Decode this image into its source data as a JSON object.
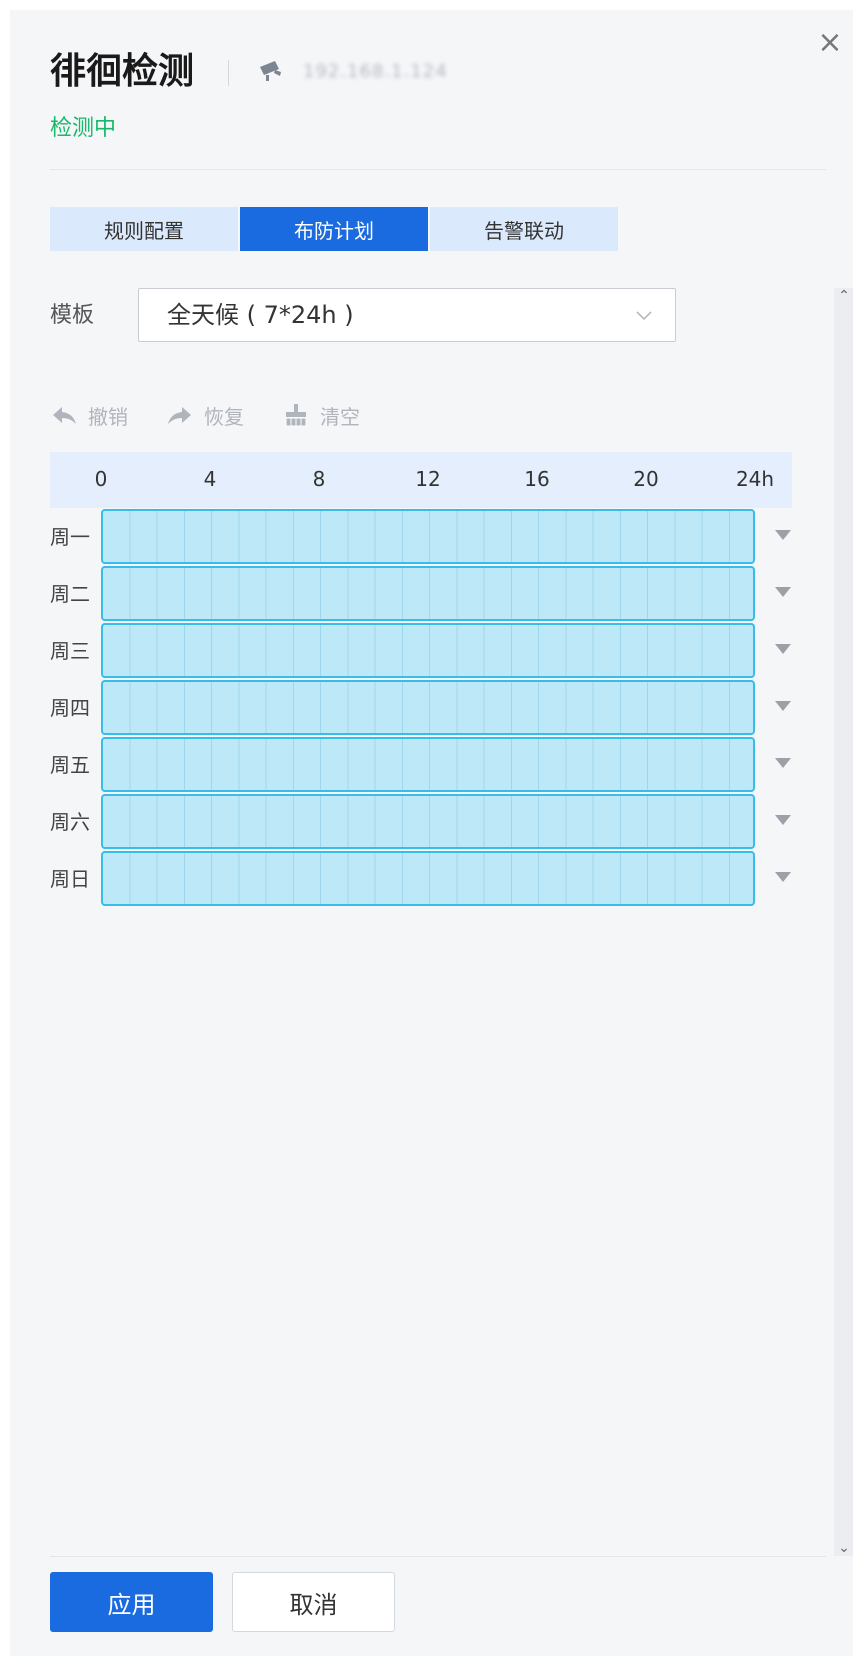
{
  "dialog": {
    "title": "徘徊检测",
    "device_ip": "192.168.1.124",
    "status": "检测中",
    "close_glyph": "×"
  },
  "tabs": [
    {
      "label": "规则配置",
      "active": false
    },
    {
      "label": "布防计划",
      "active": true
    },
    {
      "label": "告警联动",
      "active": false
    }
  ],
  "template": {
    "label": "模板",
    "value": "全天候 ( 7*24h )"
  },
  "toolbar": {
    "undo_label": "撤销",
    "redo_label": "恢复",
    "clear_label": "清空"
  },
  "schedule": {
    "hour_labels": [
      "0",
      "4",
      "8",
      "12",
      "16",
      "20",
      "24h"
    ],
    "days": [
      {
        "label": "周一",
        "ranges": [
          [
            0,
            24
          ]
        ]
      },
      {
        "label": "周二",
        "ranges": [
          [
            0,
            24
          ]
        ]
      },
      {
        "label": "周三",
        "ranges": [
          [
            0,
            24
          ]
        ]
      },
      {
        "label": "周四",
        "ranges": [
          [
            0,
            24
          ]
        ]
      },
      {
        "label": "周五",
        "ranges": [
          [
            0,
            24
          ]
        ]
      },
      {
        "label": "周六",
        "ranges": [
          [
            0,
            24
          ]
        ]
      },
      {
        "label": "周日",
        "ranges": [
          [
            0,
            24
          ]
        ]
      }
    ]
  },
  "footer": {
    "apply_label": "应用",
    "cancel_label": "取消"
  },
  "colors": {
    "accent": "#1a6ae0",
    "status_green": "#16b86a",
    "schedule_fill": "#bde8f8",
    "schedule_border": "#38bde8"
  }
}
